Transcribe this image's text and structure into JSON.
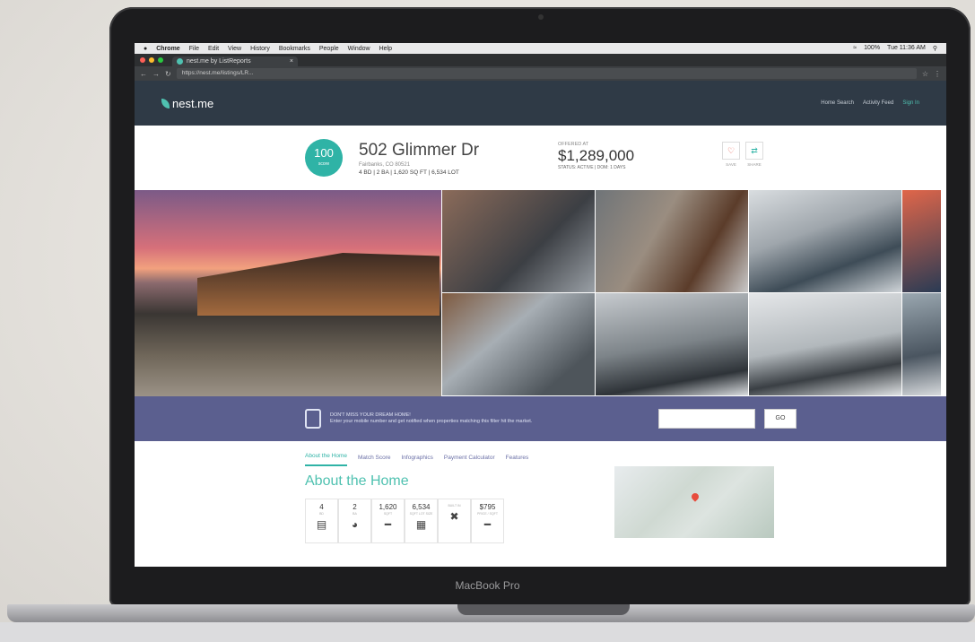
{
  "menubar": {
    "app": "Chrome",
    "items": [
      "File",
      "Edit",
      "View",
      "History",
      "Bookmarks",
      "People",
      "Window",
      "Help"
    ],
    "battery": "100%",
    "clock": "Tue 11:36 AM"
  },
  "browser": {
    "tab_title": "nest.me by ListReports",
    "url": "https://nest.me/listings/LR..."
  },
  "site": {
    "logo": "nest.me",
    "nav": [
      "Home Search",
      "Activity Feed",
      "Sign In"
    ]
  },
  "property": {
    "score": "100",
    "score_label": "score",
    "address": "502 Glimmer Dr",
    "city": "Fairbanks, CO 80521",
    "specs": "4 BD | 2 BA | 1,620 SQ FT | 6,534 LOT",
    "offered_label": "OFFERED AT",
    "price": "$1,289,000",
    "status": "STATUS: ACTIVE | DOM: 1 DAYS",
    "save_label": "SAVE",
    "share_label": "SHARE"
  },
  "cta": {
    "headline": "DON'T MISS YOUR DREAM HOME!",
    "subtext": "Enter your mobile number and get notified when properties matching this filter hit the market.",
    "input_placeholder": "",
    "button": "GO"
  },
  "subnav": [
    "About the Home",
    "Match Score",
    "Infographics",
    "Payment Calculator",
    "Features"
  ],
  "about": {
    "title": "About the Home",
    "stats": [
      {
        "value": "4",
        "label": "BD"
      },
      {
        "value": "2",
        "label": "BA"
      },
      {
        "value": "1,620",
        "label": "SQFT"
      },
      {
        "value": "6,534",
        "label": "SQFT LOT SIZE"
      },
      {
        "value": "",
        "label": "BUILT IN"
      },
      {
        "value": "$795",
        "label": "PRICE / SQFT"
      }
    ]
  },
  "laptop": {
    "model": "MacBook Pro"
  }
}
